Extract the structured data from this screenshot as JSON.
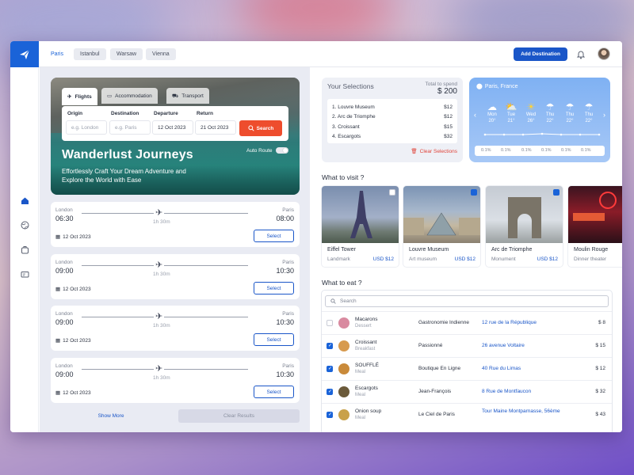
{
  "topbar": {
    "tabs": [
      {
        "label": "Paris",
        "active": true
      },
      {
        "label": "Istanbul",
        "active": false
      },
      {
        "label": "Warsaw",
        "active": false
      },
      {
        "label": "Vienna",
        "active": false
      }
    ],
    "add_destination_label": "Add Destination",
    "accent_color": "#1a56c8"
  },
  "sidebar": {
    "items": [
      "home-icon",
      "globe-icon",
      "suitcase-icon",
      "ticket-icon"
    ]
  },
  "hero": {
    "tabs": [
      "Flights",
      "Accommodation",
      "Transport"
    ],
    "fields": {
      "origin": {
        "label": "Origin",
        "placeholder": "e.g. London"
      },
      "destination": {
        "label": "Destination",
        "placeholder": "e.g. Paris"
      },
      "departure": {
        "label": "Departure",
        "value": "12 Oct 2023"
      },
      "return": {
        "label": "Return",
        "value": "21 Oct 2023"
      }
    },
    "search_label": "Search",
    "title": "Wanderlust Journeys",
    "subtitle": "Effortlessly Craft Your Dream Adventure and Explore the World with Ease",
    "auto_route_label": "Auto Route"
  },
  "flights": [
    {
      "from": "London",
      "dep": "06:30",
      "to": "Paris",
      "arr": "08:00",
      "duration": "1h 30m",
      "date": "12 Oct 2023",
      "button": "Select"
    },
    {
      "from": "London",
      "dep": "09:00",
      "to": "Paris",
      "arr": "10:30",
      "duration": "1h 30m",
      "date": "12 Oct 2023",
      "button": "Select"
    },
    {
      "from": "London",
      "dep": "09:00",
      "to": "Paris",
      "arr": "10:30",
      "duration": "1h 30m",
      "date": "12 Oct 2023",
      "button": "Select"
    },
    {
      "from": "London",
      "dep": "09:00",
      "to": "Paris",
      "arr": "10:30",
      "duration": "1h 30m",
      "date": "12 Oct 2023",
      "button": "Select"
    }
  ],
  "show_more_label": "Show More",
  "clear_results_label": "Clear Results",
  "selections": {
    "title": "Your Selections",
    "total_label": "Total to spend",
    "total": "$ 200",
    "items": [
      {
        "name": "1. Louvre Museum",
        "price": "$12"
      },
      {
        "name": "2. Arc de Triomphe",
        "price": "$12"
      },
      {
        "name": "3. Croissant",
        "price": "$15"
      },
      {
        "name": "4. Escargots",
        "price": "$32"
      }
    ],
    "clear_label": "Clear Selections"
  },
  "weather": {
    "location": "Paris, France",
    "days": [
      {
        "day": "Mon",
        "temp": "20°",
        "icon": "cloud-icon"
      },
      {
        "day": "Tue",
        "temp": "21°",
        "icon": "partly-sunny-icon"
      },
      {
        "day": "Wed",
        "temp": "26°",
        "icon": "sun-icon"
      },
      {
        "day": "Thu",
        "temp": "22°",
        "icon": "rain-icon"
      },
      {
        "day": "Thu",
        "temp": "22°",
        "icon": "rain-icon"
      },
      {
        "day": "Thu",
        "temp": "22°",
        "icon": "rain-icon"
      }
    ],
    "precip": [
      "0.1%",
      "0.1%",
      "0.1%",
      "0.1%",
      "0.1%",
      "0.1%"
    ]
  },
  "visit": {
    "title": "What to visit ?",
    "places": [
      {
        "name": "Eiffel Tower",
        "type": "Landmark",
        "price": "USD $12",
        "checked": false
      },
      {
        "name": "Louvre Museum",
        "type": "Art museum",
        "price": "USD $12",
        "checked": true
      },
      {
        "name": "Arc de Triomphe",
        "type": "Monument",
        "price": "USD $12",
        "checked": true
      },
      {
        "name": "Moulin Rouge",
        "type": "Dinner theater",
        "price": "",
        "checked": false
      }
    ]
  },
  "eat": {
    "title": "What to eat ?",
    "search_placeholder": "Search",
    "rows": [
      {
        "name": "Macarons",
        "category": "Dessert",
        "place": "Gastronomie Indienne",
        "address": "12 rue de la République",
        "price": "$ 8",
        "checked": false,
        "color": "#d98aa0"
      },
      {
        "name": "Croissant",
        "category": "Breakfast",
        "place": "Passionné",
        "address": "26 avenue Voltaire",
        "price": "$ 15",
        "checked": true,
        "color": "#d79a4e"
      },
      {
        "name": "SOUFFLÉ",
        "category": "Meal",
        "place": "Boutique En Ligne",
        "address": "40 Rue du Limas",
        "price": "$ 12",
        "checked": true,
        "color": "#c98a3a"
      },
      {
        "name": "Escargots",
        "category": "Meal",
        "place": "Jean-François",
        "address": "8 Rue de Montfaucon",
        "price": "$ 32",
        "checked": true,
        "color": "#6b5a3a"
      },
      {
        "name": "Onion soup",
        "category": "Meal",
        "place": "Le Ciel de Paris",
        "address": "Tour Maine Montparnasse, 56ème",
        "price": "$ 43",
        "checked": true,
        "color": "#c9a14a"
      }
    ]
  }
}
